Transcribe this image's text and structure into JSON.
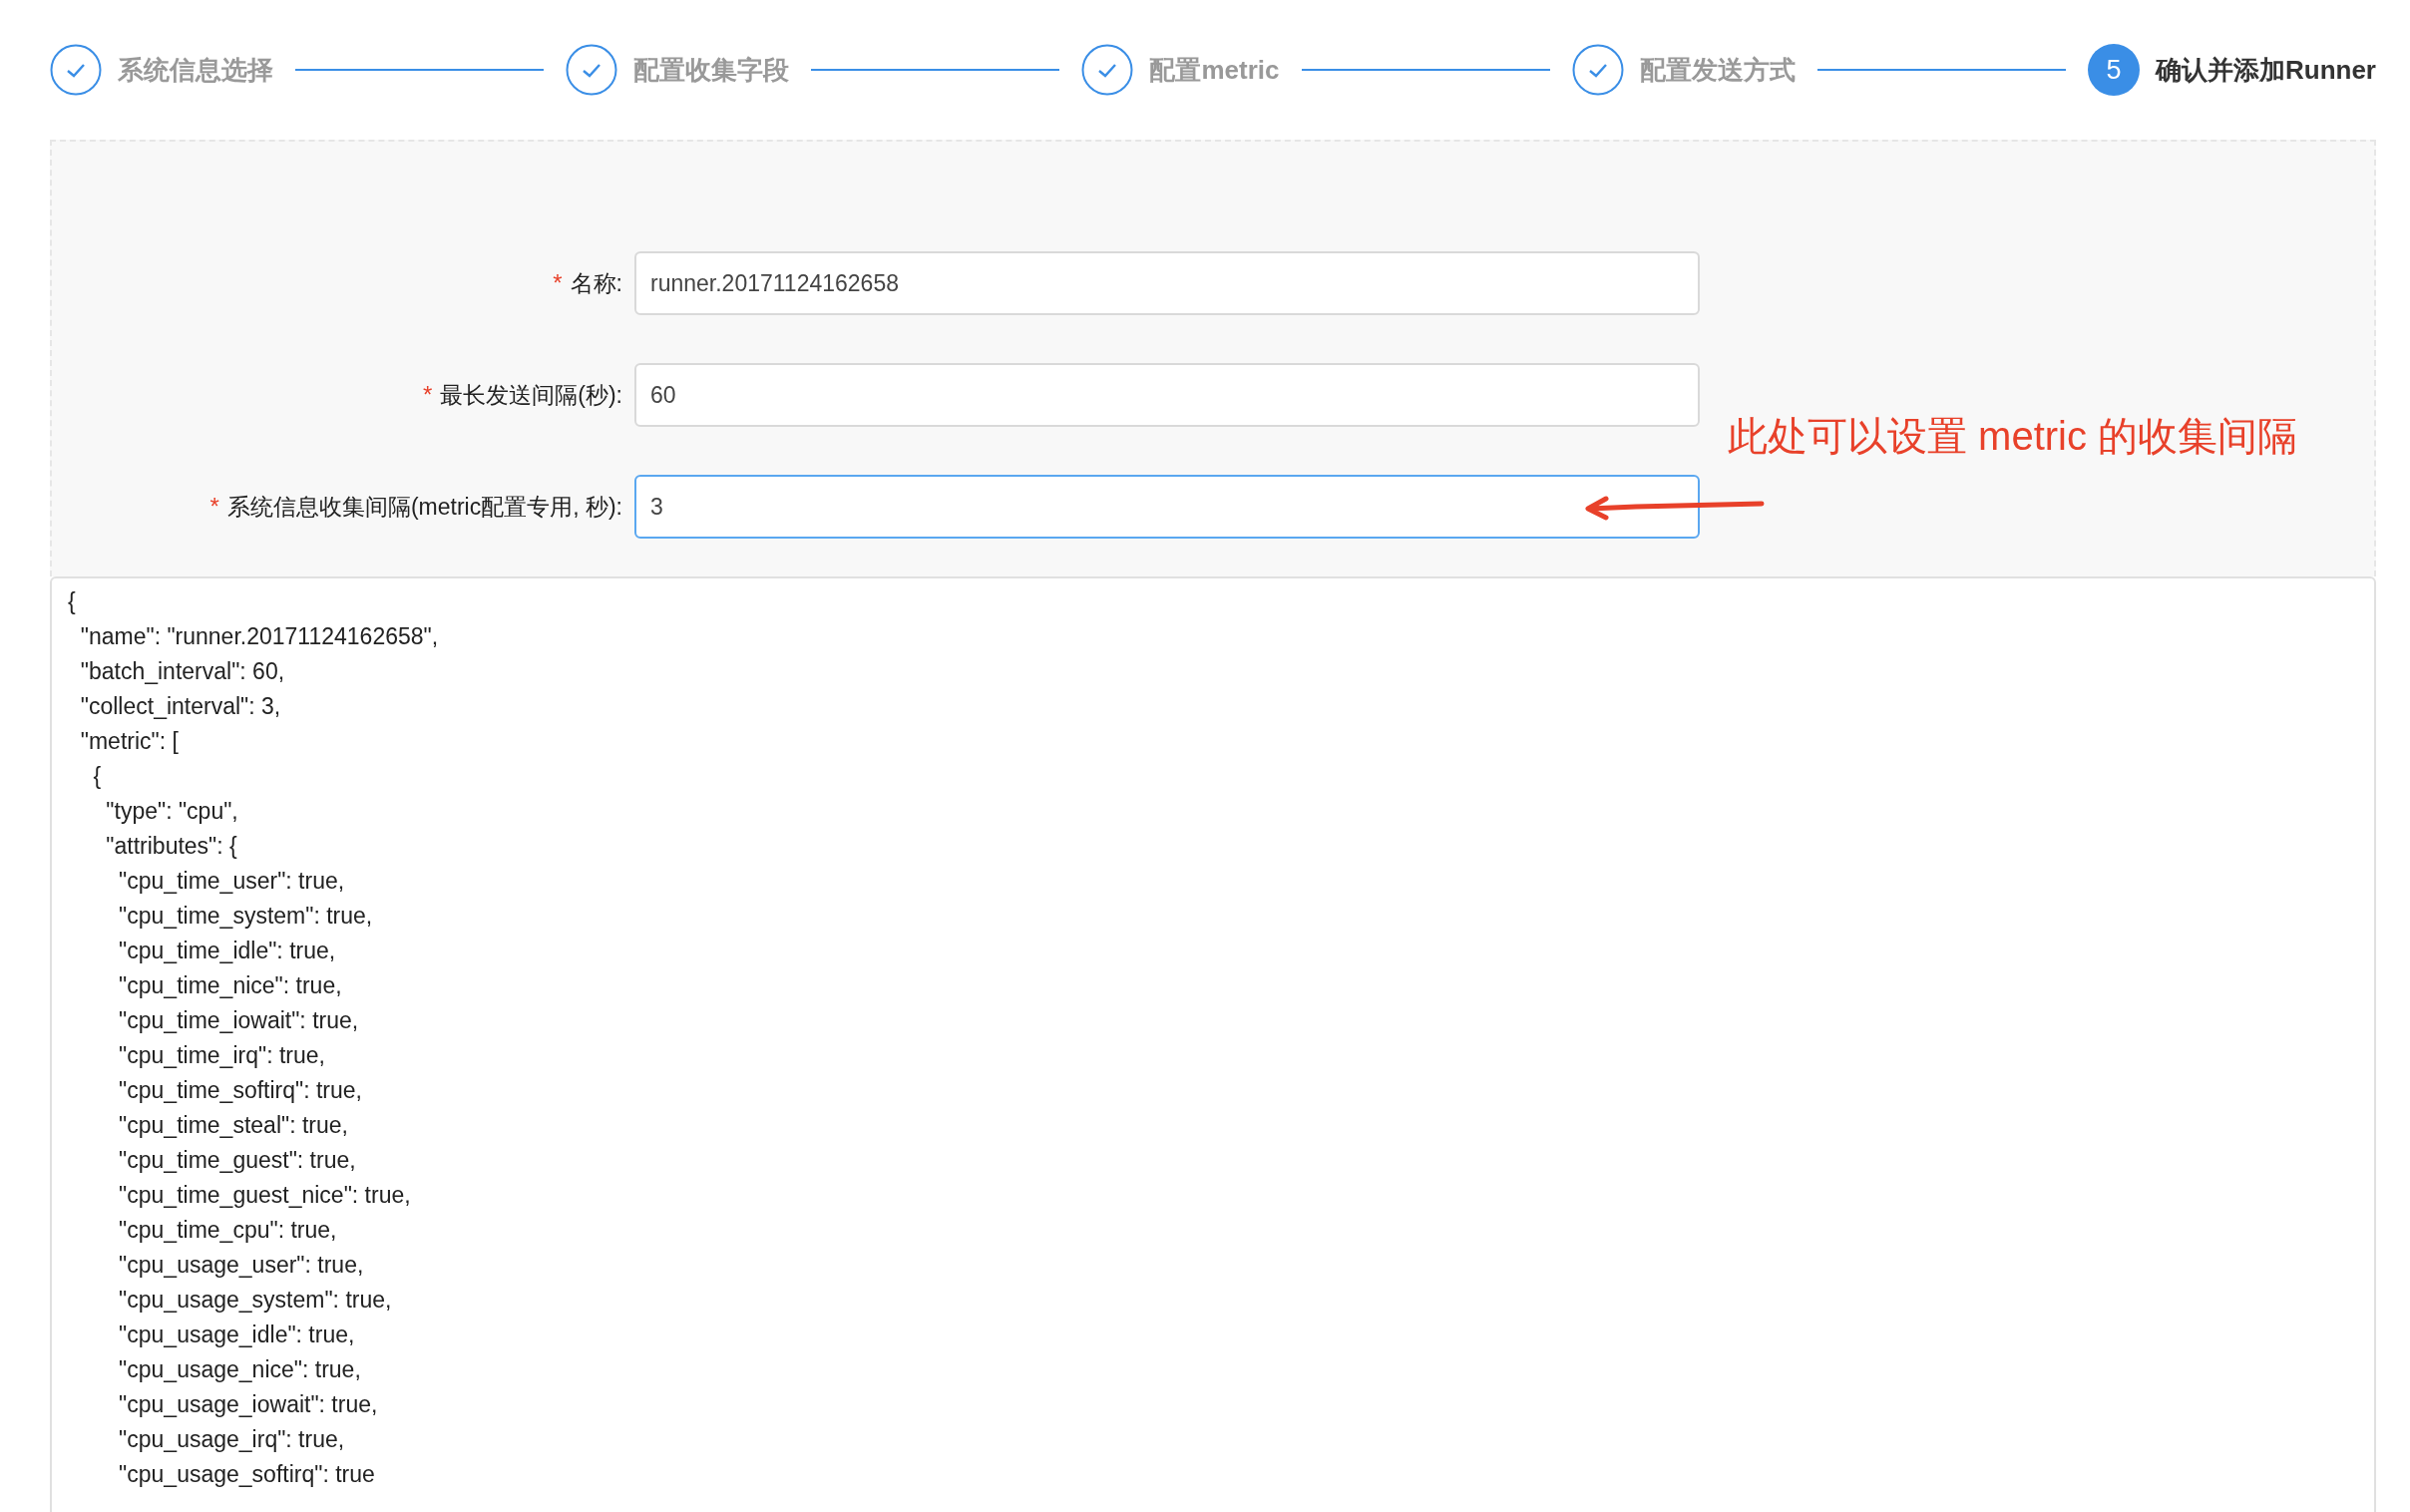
{
  "steps": [
    {
      "label": "系统信息选择",
      "completed": true
    },
    {
      "label": "配置收集字段",
      "completed": true
    },
    {
      "label": "配置metric",
      "completed": true
    },
    {
      "label": "配置发送方式",
      "completed": true
    },
    {
      "label": "确认并添加Runner",
      "completed": false,
      "number": "5"
    }
  ],
  "form": {
    "fields": [
      {
        "required_mark": "*",
        "label": "名称:",
        "value": "runner.20171124162658",
        "focused": false
      },
      {
        "required_mark": "*",
        "label": "最长发送间隔(秒):",
        "value": "60",
        "focused": false
      },
      {
        "required_mark": "*",
        "label": "系统信息收集间隔(metric配置专用, 秒):",
        "value": "3",
        "focused": true
      }
    ],
    "annotation": "此处可以设置 metric 的收集间隔"
  },
  "config_preview": {
    "lines": [
      "{",
      "  \"name\": \"runner.20171124162658\",",
      "  \"batch_interval\": 60,",
      "  \"collect_interval\": 3,",
      "  \"metric\": [",
      "    {",
      "      \"type\": \"cpu\",",
      "      \"attributes\": {",
      "        \"cpu_time_user\": true,",
      "        \"cpu_time_system\": true,",
      "        \"cpu_time_idle\": true,",
      "        \"cpu_time_nice\": true,",
      "        \"cpu_time_iowait\": true,",
      "        \"cpu_time_irq\": true,",
      "        \"cpu_time_softirq\": true,",
      "        \"cpu_time_steal\": true,",
      "        \"cpu_time_guest\": true,",
      "        \"cpu_time_guest_nice\": true,",
      "        \"cpu_time_cpu\": true,",
      "        \"cpu_usage_user\": true,",
      "        \"cpu_usage_system\": true,",
      "        \"cpu_usage_idle\": true,",
      "        \"cpu_usage_nice\": true,",
      "        \"cpu_usage_iowait\": true,",
      "        \"cpu_usage_irq\": true,",
      "        \"cpu_usage_softirq\": true"
    ]
  }
}
